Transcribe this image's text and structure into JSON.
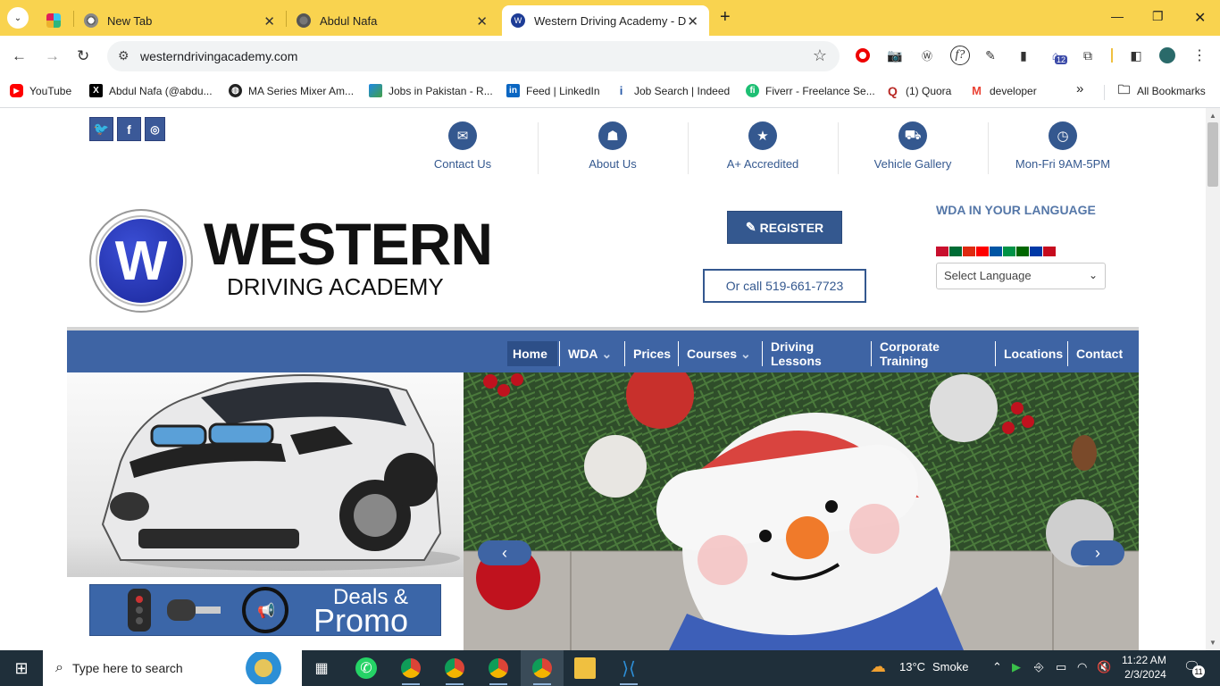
{
  "browser": {
    "tabs": [
      {
        "title": "",
        "favicon": "slack-icon"
      },
      {
        "title": "New Tab",
        "favicon": "chrome-icon"
      },
      {
        "title": "Abdul Nafa",
        "favicon": "globe-icon"
      },
      {
        "title": "Western Driving Academy - Dri",
        "favicon": "wda-icon",
        "active": true
      }
    ],
    "new_tab": "+",
    "address": "westerndrivingacademy.com",
    "window_controls": [
      "minimize",
      "restore",
      "close"
    ],
    "extensions": [
      "opera-icon",
      "camera-icon",
      "wordpress-icon",
      "font-icon",
      "eyedropper-icon",
      "book-icon",
      "graduation-icon",
      "puzzle-icon",
      "sidepanel-icon",
      "profile-avatar"
    ],
    "extension_badge": "12",
    "bookmarks": [
      {
        "label": "YouTube",
        "icon": "youtube-icon",
        "color": "#ff0000"
      },
      {
        "label": "Abdul Nafa (@abdu...",
        "icon": "x-icon",
        "color": "#000000"
      },
      {
        "label": "MA Series Mixer Am...",
        "icon": "globe-icon",
        "color": "#222222"
      },
      {
        "label": "Jobs in Pakistan - R...",
        "icon": "jobs-icon",
        "color": "#1e88e5"
      },
      {
        "label": "Feed | LinkedIn",
        "icon": "linkedin-icon",
        "color": "#0a66c2"
      },
      {
        "label": "Job Search | Indeed",
        "icon": "indeed-icon",
        "color": "#2557a7"
      },
      {
        "label": "Fiverr - Freelance Se...",
        "icon": "fiverr-icon",
        "color": "#1dbf73"
      },
      {
        "label": "(1) Quora",
        "icon": "quora-icon",
        "color": "#b92b27"
      },
      {
        "label": "developer",
        "icon": "gmail-icon",
        "color": "#ea4335"
      }
    ],
    "bookmarks_more": "»",
    "all_bookmarks": "All Bookmarks"
  },
  "site": {
    "social": [
      "twitter-icon",
      "facebook-icon",
      "instagram-icon"
    ],
    "top_links": [
      {
        "label": "Contact Us",
        "icon": "envelope-icon",
        "glyph": "✉"
      },
      {
        "label": "About Us",
        "icon": "people-icon",
        "glyph": "☗"
      },
      {
        "label": "A+ Accredited",
        "icon": "star-icon",
        "glyph": "★"
      },
      {
        "label": "Vehicle Gallery",
        "icon": "car-icon",
        "glyph": "⛟"
      },
      {
        "label": "Mon-Fri 9AM-5PM",
        "icon": "clock-icon",
        "glyph": "◷"
      }
    ],
    "logo": {
      "letter": "W",
      "line1": "WESTERN",
      "line2": "DRIVING ACADEMY"
    },
    "register": "REGISTER",
    "call": "Or call 519-661-7723",
    "language_title": "WDA IN YOUR LANGUAGE",
    "language_select": "Select Language",
    "flags": [
      "#c8102e",
      "#006c35",
      "#de2910",
      "#fe0000",
      "#0055a4",
      "#009246",
      "#006600",
      "#0039a6",
      "#c60b1e"
    ],
    "nav": [
      {
        "label": "Home",
        "active": true,
        "dropdown": false
      },
      {
        "label": "WDA",
        "dropdown": true
      },
      {
        "label": "Prices",
        "dropdown": false
      },
      {
        "label": "Courses",
        "dropdown": true
      },
      {
        "label": "Driving Lessons",
        "dropdown": false
      },
      {
        "label": "Corporate Training",
        "dropdown": false
      },
      {
        "label": "Locations",
        "dropdown": false
      },
      {
        "label": "Contact",
        "dropdown": false
      }
    ],
    "deals_line1": "Deals &",
    "deals_line2": "Promo",
    "slider_prev": "‹",
    "slider_next": "›"
  },
  "taskbar": {
    "search_placeholder": "Type here to search",
    "weather_temp": "13°C",
    "weather_text": "Smoke",
    "time": "11:22 AM",
    "date": "2/3/2024",
    "notifications": "11"
  }
}
